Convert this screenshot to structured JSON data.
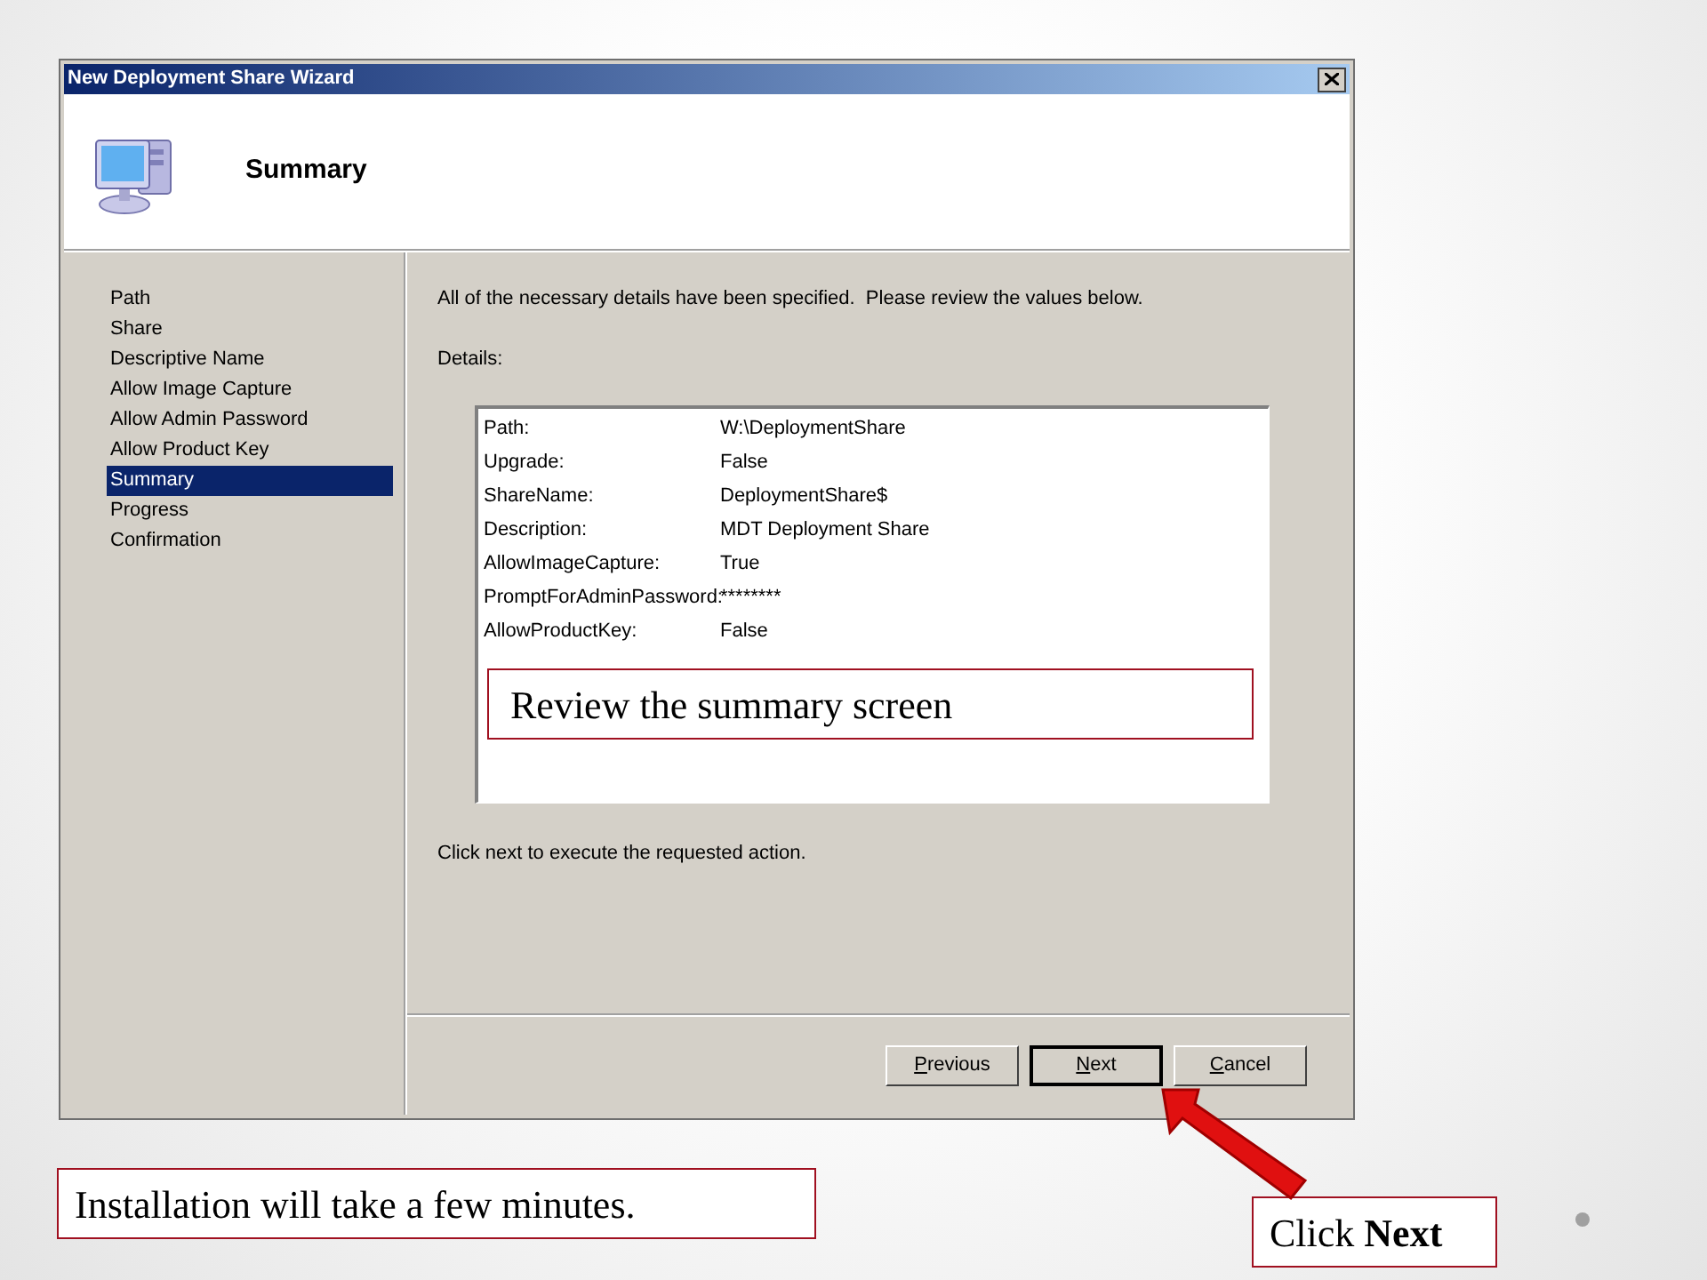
{
  "window": {
    "title": "New Deployment Share Wizard"
  },
  "header": {
    "title": "Summary"
  },
  "steps": [
    {
      "label": "Path",
      "selected": false
    },
    {
      "label": "Share",
      "selected": false
    },
    {
      "label": "Descriptive Name",
      "selected": false
    },
    {
      "label": "Allow Image Capture",
      "selected": false
    },
    {
      "label": "Allow Admin Password",
      "selected": false
    },
    {
      "label": "Allow Product Key",
      "selected": false
    },
    {
      "label": "Summary",
      "selected": true
    },
    {
      "label": "Progress",
      "selected": false
    },
    {
      "label": "Confirmation",
      "selected": false
    }
  ],
  "intro": "All of the necessary details have been specified.  Please review the values below.",
  "details_label": "Details:",
  "details": [
    {
      "name": "Path:",
      "value": "W:\\DeploymentShare"
    },
    {
      "name": "Upgrade:",
      "value": "False"
    },
    {
      "name": "ShareName:",
      "value": "DeploymentShare$"
    },
    {
      "name": "Description:",
      "value": "MDT Deployment Share"
    },
    {
      "name": "AllowImageCapture:",
      "value": "True"
    },
    {
      "name": "PromptForAdminPassword:",
      "value": "********"
    },
    {
      "name": "AllowProductKey:",
      "value": "False"
    }
  ],
  "footer_note": "Click next to execute the requested action.",
  "buttons": [
    {
      "label": "Previous",
      "default": false
    },
    {
      "label": "Next",
      "default": true
    },
    {
      "label": "Cancel",
      "default": false
    }
  ],
  "callouts": [
    "Review the summary screen",
    "Installation will take a few minutes.",
    "Click **Next**"
  ]
}
